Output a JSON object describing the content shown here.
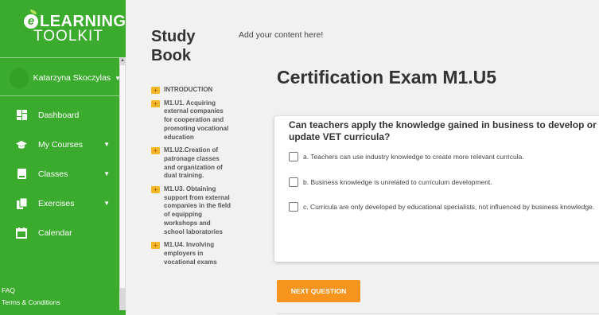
{
  "sidebar": {
    "logo_line1": "LEARNING",
    "logo_line2": "TOOLKIT",
    "logo_mark": "e",
    "user_name": "Katarzyna Skoczylas",
    "nav": [
      {
        "label": "Dashboard",
        "icon": "dashboard-icon",
        "has_caret": false
      },
      {
        "label": "My Courses",
        "icon": "graduation-cap-icon",
        "has_caret": true
      },
      {
        "label": "Classes",
        "icon": "book-icon",
        "has_caret": true
      },
      {
        "label": "Exercises",
        "icon": "copy-icon",
        "has_caret": true
      },
      {
        "label": "Calendar",
        "icon": "calendar-icon",
        "has_caret": false
      }
    ],
    "footer": {
      "faq": "FAQ",
      "terms": "Terms & Conditions"
    },
    "colors": {
      "background": "#3bab2e",
      "text": "#ffffff"
    }
  },
  "book": {
    "title": "Study Book",
    "toc": [
      "INTRODUCTION",
      "M1.U1. Acquiring external companies for cooperation and promoting vocational education",
      "M1.U2.Creation of patronage classes and organization of dual training.",
      "M1.U3. Obtaining support from external companies in the field of equipping workshops and school laboratories",
      "M1.U4. Involving employers in vocational exams"
    ]
  },
  "main": {
    "add_content": "Add your content here!",
    "exam_title": "Certification Exam M1.U5",
    "question": "Can teachers apply the knowledge gained in business to develop or update VET curricula?",
    "options": [
      "a. Teachers can use industry knowledge to create more relevant curricula.",
      "b. Business knowledge is unrelated to curriculum development.",
      "c. Curricula are only developed by educational specialists, not influenced by business knowledge."
    ],
    "next_button": "NEXT QUESTION",
    "colors": {
      "accent": "#f7941d",
      "toc_icon": "#f5b72a"
    }
  }
}
